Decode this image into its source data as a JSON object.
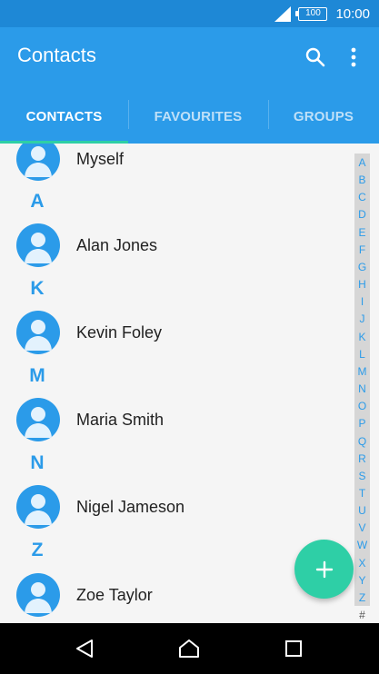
{
  "status": {
    "battery": "100",
    "time": "10:00"
  },
  "app_bar": {
    "title": "Contacts"
  },
  "tabs": [
    {
      "label": "CONTACTS",
      "active": true
    },
    {
      "label": "FAVOURITES",
      "active": false
    },
    {
      "label": "GROUPS",
      "active": false
    }
  ],
  "contacts": {
    "self": "Myself",
    "sections": [
      {
        "letter": "A",
        "name": "Alan Jones"
      },
      {
        "letter": "K",
        "name": "Kevin Foley"
      },
      {
        "letter": "M",
        "name": "Maria Smith"
      },
      {
        "letter": "N",
        "name": "Nigel Jameson"
      },
      {
        "letter": "Z",
        "name": "Zoe Taylor"
      }
    ]
  },
  "index_letters": [
    "A",
    "B",
    "C",
    "D",
    "E",
    "F",
    "G",
    "H",
    "I",
    "J",
    "K",
    "L",
    "M",
    "N",
    "O",
    "P",
    "Q",
    "R",
    "S",
    "T",
    "U",
    "V",
    "W",
    "X",
    "Y",
    "Z"
  ],
  "index_hash": "#",
  "colors": {
    "primary": "#2b9be9",
    "status_bar": "#1e88d6",
    "accent": "#2ecfa6"
  },
  "icons": {
    "search": "search-icon",
    "more": "more-vert-icon",
    "add": "plus-icon",
    "back": "back-icon",
    "home": "home-icon",
    "recents": "recents-icon"
  }
}
